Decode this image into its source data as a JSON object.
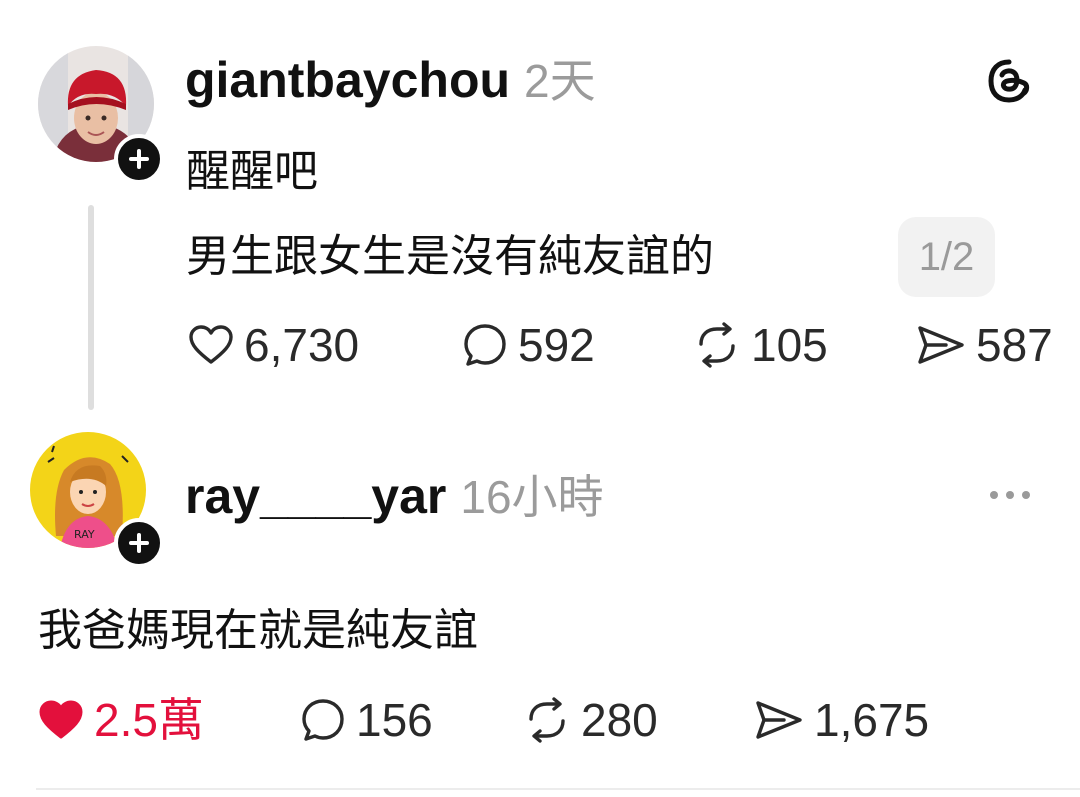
{
  "post": {
    "username": "giantbaychou",
    "time": "2天",
    "line1": "醒醒吧",
    "line2": "男生跟女生是沒有純友誼的",
    "page_indicator": "1/2",
    "likes": "6,730",
    "comments": "592",
    "reposts": "105",
    "shares": "587",
    "app_icon": "threads-logo-icon"
  },
  "reply": {
    "username": "ray____yar",
    "time": "16小時",
    "text": "我爸媽現在就是純友誼",
    "likes": "2.5萬",
    "comments": "156",
    "reposts": "280",
    "shares": "1,675",
    "more_icon": "more-options-icon"
  },
  "colors": {
    "liked": "#e3103c",
    "muted": "#9b9b9b",
    "thread_line": "#dedede"
  }
}
